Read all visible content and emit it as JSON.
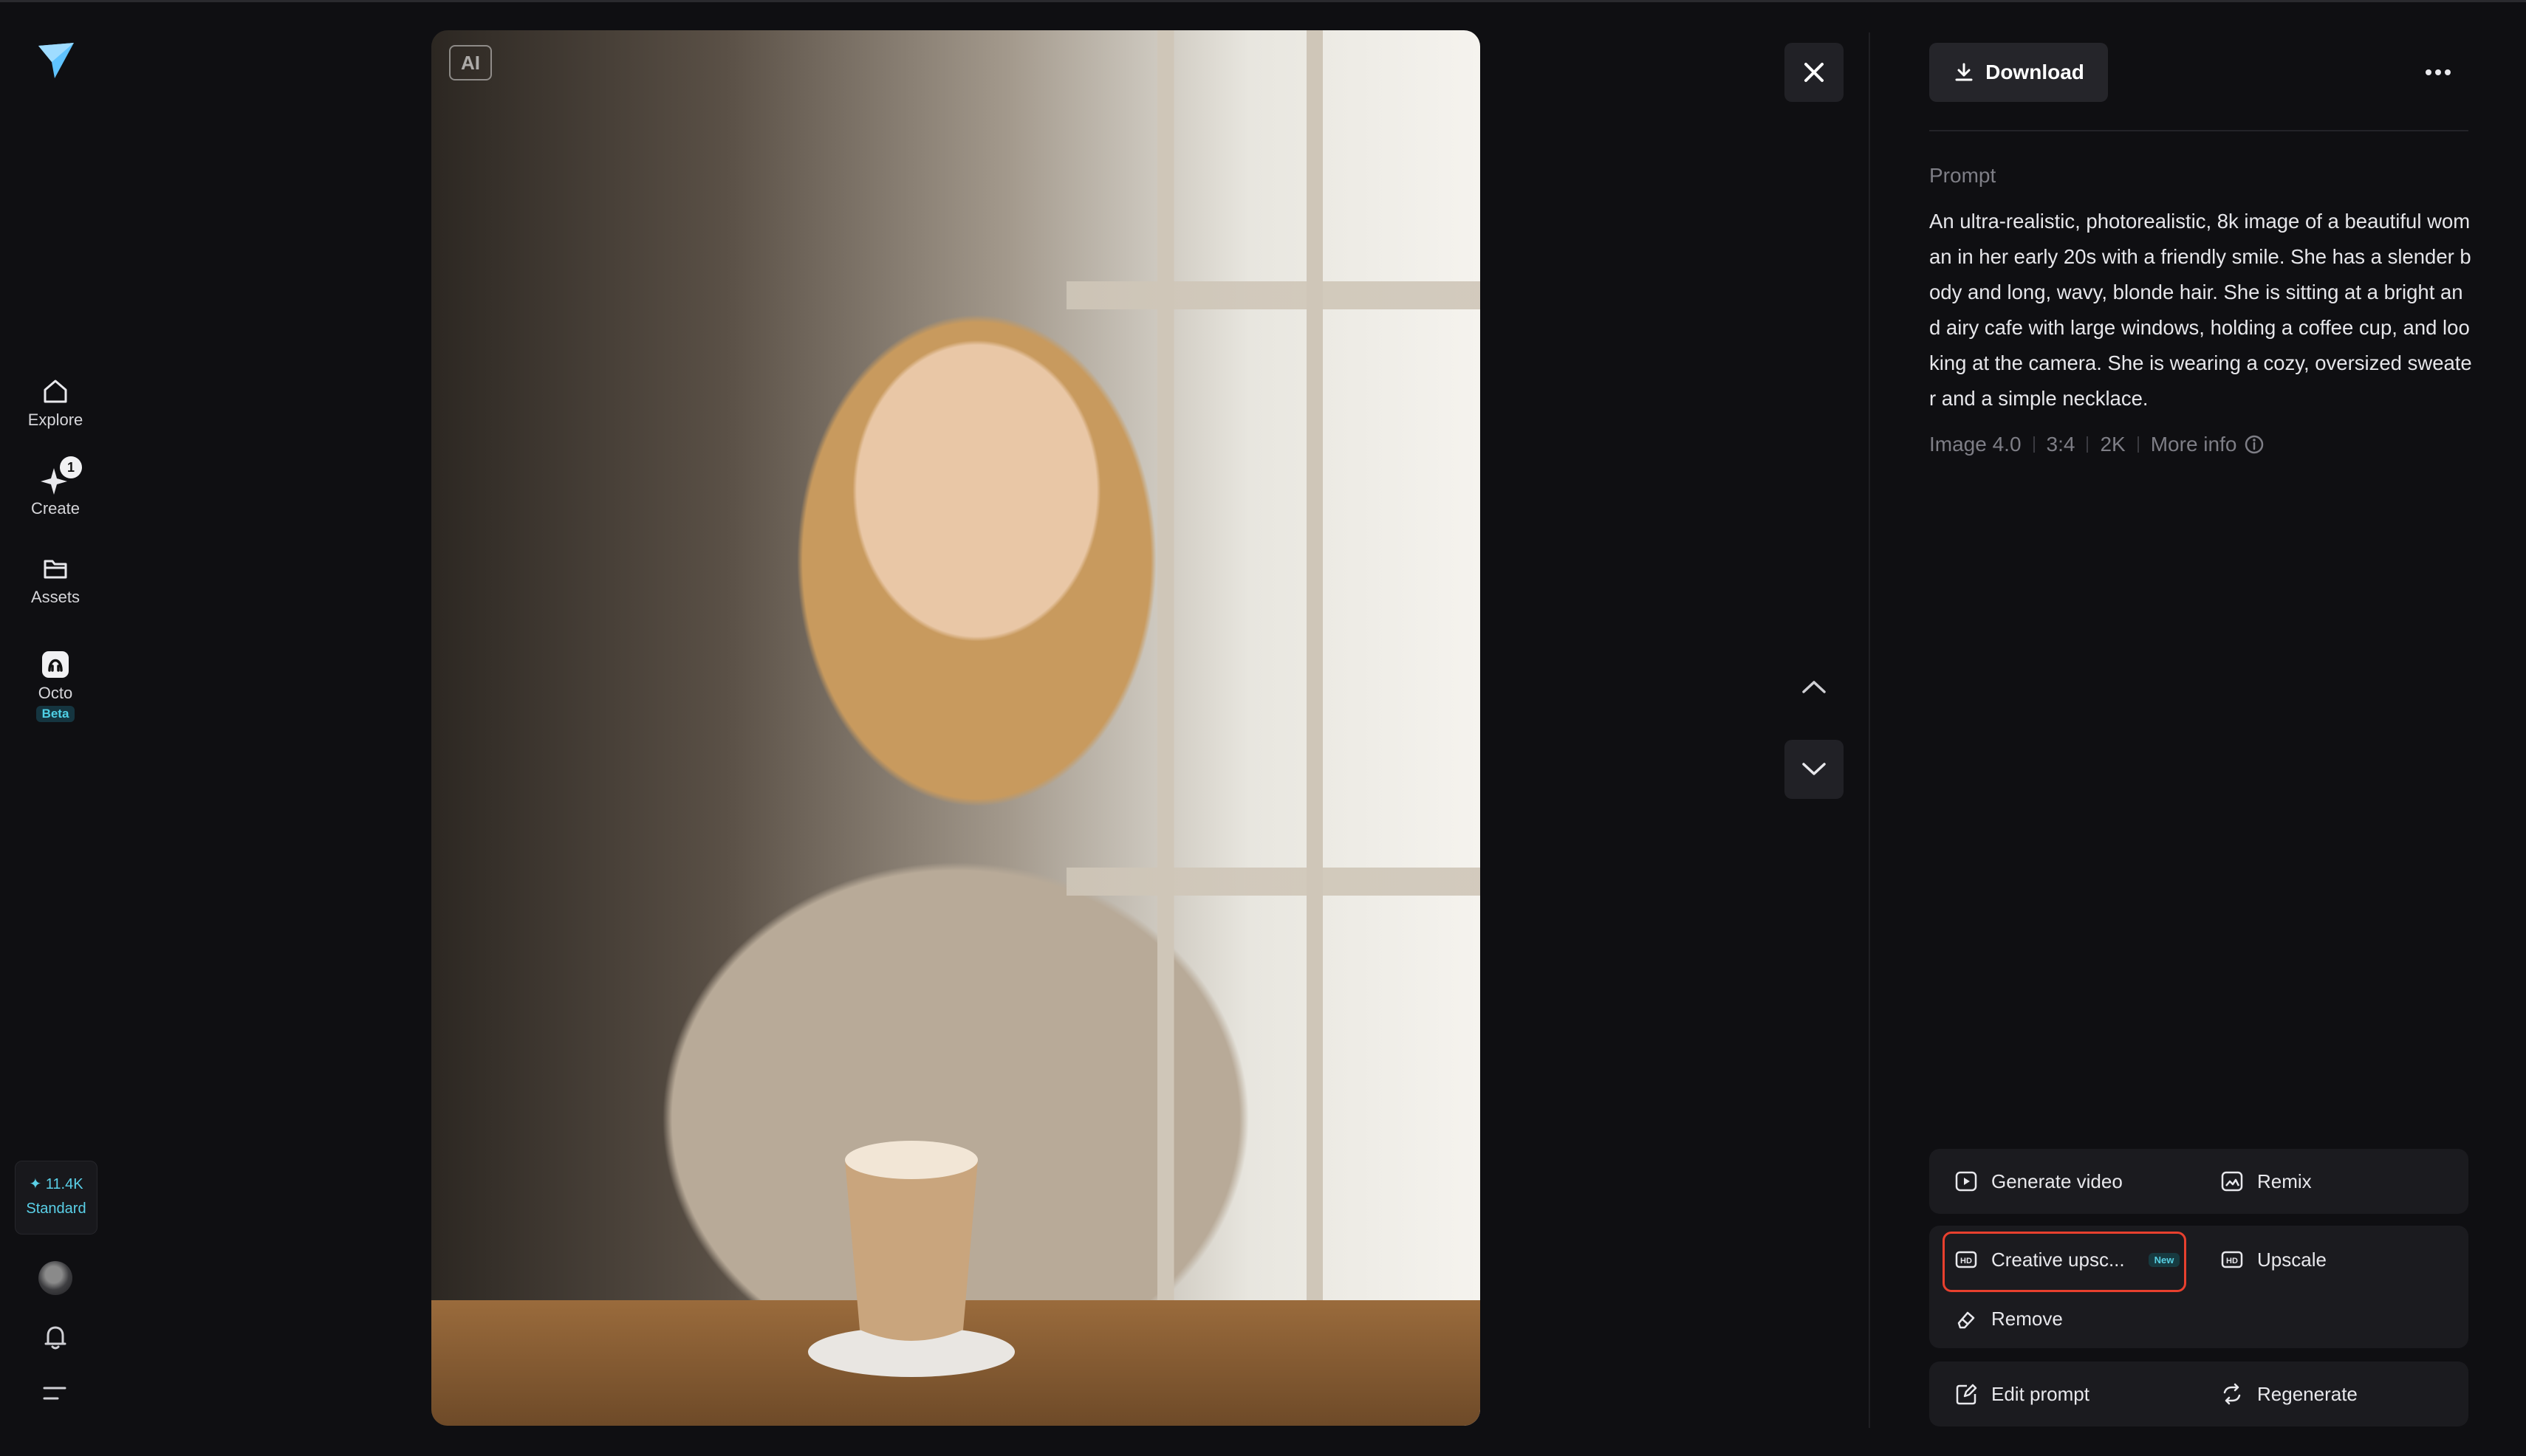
{
  "nav": {
    "items": [
      {
        "label": "Explore"
      },
      {
        "label": "Create",
        "badge": "1"
      },
      {
        "label": "Assets"
      },
      {
        "label": "Octo",
        "tag": "Beta"
      }
    ],
    "credits": {
      "amount": "✦ 11.4K",
      "tier": "Standard"
    }
  },
  "image": {
    "ai_badge": "AI"
  },
  "panel": {
    "download_label": "Download",
    "prompt_label": "Prompt",
    "prompt_text": "An ultra-realistic, photorealistic, 8k image of a beautiful woman in her early 20s with a friendly smile. She has a slender body and long, wavy, blonde hair. She is sitting at a bright and airy cafe with large windows, holding a coffee cup, and looking at the camera. She is wearing a cozy, oversized sweater and a simple necklace.",
    "meta": {
      "model": "Image 4.0",
      "ratio": "3:4",
      "resolution": "2K",
      "more_info": "More info"
    },
    "actions": {
      "generate_video": "Generate video",
      "remix": "Remix",
      "creative_upscale": "Creative upsc...",
      "new_tag": "New",
      "upscale": "Upscale",
      "remove": "Remove",
      "edit_prompt": "Edit prompt",
      "regenerate": "Regenerate"
    }
  },
  "colors": {
    "accent": "#4fd0e6",
    "highlight": "#e8402e",
    "background": "#0f0f12"
  },
  "icons": [
    "logo-icon",
    "home-icon",
    "sparkle-icon",
    "folder-icon",
    "octo-icon",
    "bell-icon",
    "menu-icon",
    "close-icon",
    "chevron-up-icon",
    "chevron-down-icon",
    "download-icon",
    "more-icon",
    "info-icon",
    "play-icon",
    "remix-icon",
    "hd-icon",
    "eraser-icon",
    "edit-icon",
    "refresh-icon"
  ]
}
